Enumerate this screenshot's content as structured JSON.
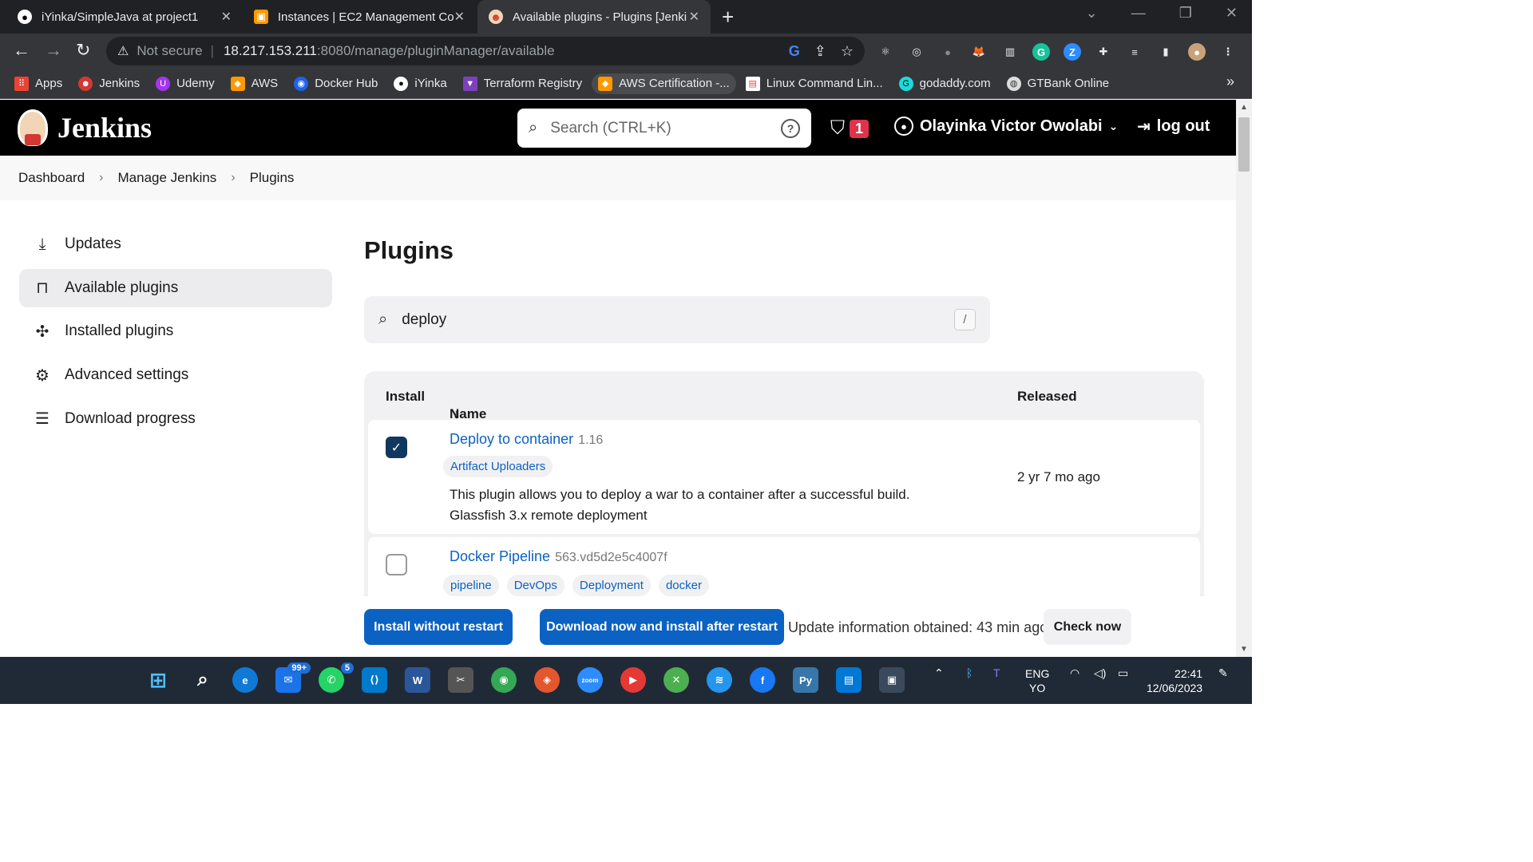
{
  "browser": {
    "tabs": [
      {
        "title": "iYinka/SimpleJava at project1",
        "icon": "github-icon"
      },
      {
        "title": "Instances | EC2 Management Cor",
        "icon": "aws-icon"
      },
      {
        "title": "Available plugins - Plugins [Jenki",
        "icon": "jenkins-icon"
      }
    ],
    "url_warning": "Not secure",
    "url_host": "18.217.153.211",
    "url_path": ":8080/manage/pluginManager/available",
    "bookmarks": [
      {
        "label": "Apps",
        "color": "#ea4335"
      },
      {
        "label": "Jenkins",
        "color": "#d33833"
      },
      {
        "label": "Udemy",
        "color": "#a435f0"
      },
      {
        "label": "AWS",
        "color": "#ff9900"
      },
      {
        "label": "Docker Hub",
        "color": "#1d63ed"
      },
      {
        "label": "iYinka",
        "color": "#333333"
      },
      {
        "label": "Terraform Registry",
        "color": "#7b42bc"
      },
      {
        "label": "AWS Certification -...",
        "color": "#ff9900"
      },
      {
        "label": "Linux Command Lin...",
        "color": "#e74c3c"
      },
      {
        "label": "godaddy.com",
        "color": "#1bdbdb"
      },
      {
        "label": "GTBank Online",
        "color": "#dddddd"
      }
    ]
  },
  "jenkins": {
    "brand": "Jenkins",
    "search_placeholder": "Search (CTRL+K)",
    "alert_count": "1",
    "user_name": "Olayinka Victor Owolabi",
    "logout_label": "log out",
    "breadcrumb": [
      "Dashboard",
      "Manage Jenkins",
      "Plugins"
    ],
    "sidebar": [
      {
        "label": "Updates",
        "icon": "download-icon"
      },
      {
        "label": "Available plugins",
        "icon": "shopping-bag-icon"
      },
      {
        "label": "Installed plugins",
        "icon": "puzzle-icon"
      },
      {
        "label": "Advanced settings",
        "icon": "gear-icon"
      },
      {
        "label": "Download progress",
        "icon": "list-icon"
      }
    ],
    "page_title": "Plugins",
    "filter_value": "deploy",
    "filter_shortcut": "/",
    "table": {
      "col_install": "Install",
      "col_name": "Name",
      "col_sort_indicator": "↓",
      "col_released": "Released",
      "rows": [
        {
          "name": "Deploy to container",
          "version": "1.16",
          "checked": true,
          "tags": [
            "Artifact Uploaders"
          ],
          "desc_line1": "This plugin allows you to deploy a war to a container after a successful build.",
          "desc_line2": "Glassfish 3.x remote deployment",
          "released": "2 yr 7 mo ago"
        },
        {
          "name": "Docker Pipeline",
          "version": "563.vd5d2e5c4007f",
          "checked": false,
          "tags": [
            "pipeline",
            "DevOps",
            "Deployment",
            "docker"
          ]
        }
      ]
    },
    "actions": {
      "install_now": "Install without restart",
      "install_later": "Download now and install after restart",
      "update_info": "Update information obtained: 43 min ago",
      "check_now": "Check now"
    }
  },
  "taskbar": {
    "mail_badge": "99+",
    "whatsapp_badge": "5",
    "lang_top": "ENG",
    "lang_bottom": "YO",
    "time": "22:41",
    "date": "12/06/2023"
  }
}
